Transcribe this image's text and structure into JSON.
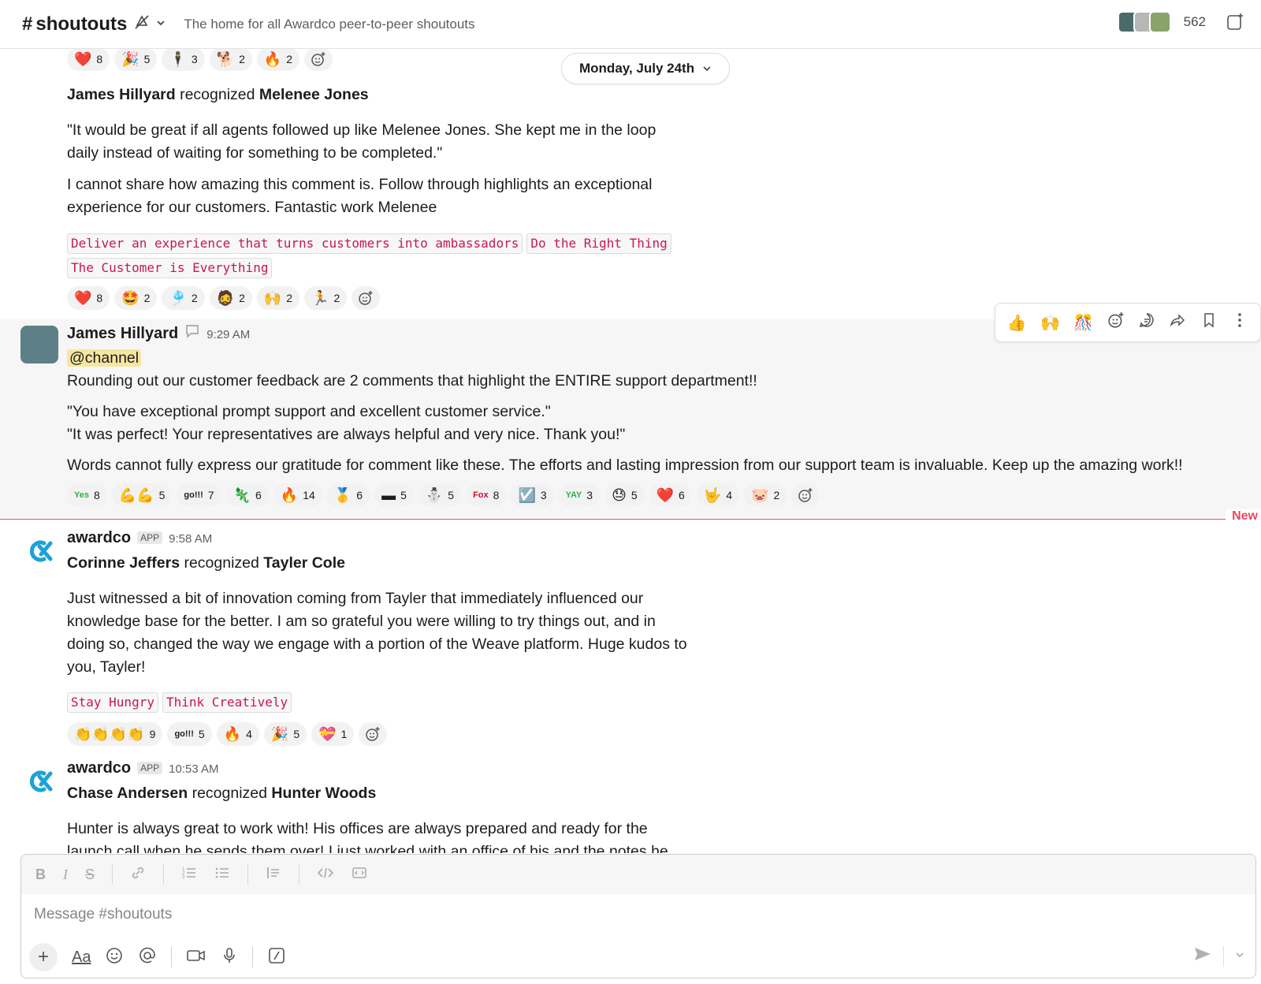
{
  "header": {
    "hash": "#",
    "channel_name": "shoutouts",
    "topic": "The home for all Awardco peer-to-peer shoutouts",
    "member_count": "562"
  },
  "date_pill": {
    "label": "Monday, July 24th"
  },
  "messages": [
    {
      "top_reactions": [
        {
          "emoji": "❤️",
          "count": "8"
        },
        {
          "emoji": "🎉",
          "count": "5"
        },
        {
          "emoji": "🕴",
          "count": "3"
        },
        {
          "emoji": "🐕",
          "count": "2"
        },
        {
          "emoji": "🔥",
          "count": "2"
        }
      ],
      "giver": "James Hillyard",
      "verb": "recognized",
      "receiver": "Melenee Jones",
      "quote": "\"It would be great if all agents followed up like Melenee Jones.  She kept me in the loop daily instead of waiting for something to be completed.\"",
      "comment": "I cannot share how amazing this comment is. Follow through highlights an exceptional experience for our customers. Fantastic work Melenee",
      "tags": [
        "Deliver an experience that turns customers into ambassadors",
        "Do the Right Thing",
        "The Customer is Everything"
      ],
      "reactions": [
        {
          "emoji": "❤️",
          "count": "8"
        },
        {
          "emoji": "🤩",
          "count": "2"
        },
        {
          "emoji": "🎐",
          "count": "2"
        },
        {
          "emoji": "🧔",
          "count": "2"
        },
        {
          "emoji": "🙌",
          "count": "2"
        },
        {
          "emoji": "🏃",
          "count": "2"
        }
      ]
    },
    {
      "sender": "James Hillyard",
      "time": "9:29 AM",
      "mention": "@channel",
      "line1": "Rounding out our customer feedback are 2 comments that highlight the ENTIRE support department!!",
      "quote1": "\"You have exceptional prompt support and excellent customer service.\"",
      "quote2": "\"It was perfect! Your representatives are always helpful and very nice. Thank you!\"",
      "line2": "Words cannot fully express our gratitude for comment like these. The efforts and lasting impression from our support team is invaluable. Keep up the amazing work!!",
      "reactions": [
        {
          "emoji": "Yes",
          "count": "8",
          "text": true
        },
        {
          "emoji": "💪💪",
          "count": "5"
        },
        {
          "emoji": "go!!!",
          "count": "7",
          "text": true
        },
        {
          "emoji": "🦎",
          "count": "6"
        },
        {
          "emoji": "🔥",
          "count": "14"
        },
        {
          "emoji": "🥇",
          "count": "6"
        },
        {
          "emoji": "▬",
          "count": "5"
        },
        {
          "emoji": "⛄",
          "count": "5"
        },
        {
          "emoji": "Fox",
          "count": "8",
          "text": true
        },
        {
          "emoji": "☑️",
          "count": "3"
        },
        {
          "emoji": "YAY",
          "count": "3",
          "text": true
        },
        {
          "emoji": "😓",
          "count": "5"
        },
        {
          "emoji": "❤️",
          "count": "6"
        },
        {
          "emoji": "🤟",
          "count": "4"
        },
        {
          "emoji": "🐷",
          "count": "2"
        }
      ]
    },
    {
      "sender": "awardco",
      "badge": "APP",
      "time": "9:58 AM",
      "giver": "Corinne Jeffers",
      "verb": "recognized",
      "receiver": "Tayler Cole",
      "body": "Just witnessed a bit of innovation coming from Tayler that immediately influenced our knowledge base for the better.  I am so grateful you were willing to try things out, and in doing so, changed the way we engage with a portion of the Weave platform.  Huge kudos to you, Tayler!",
      "tags": [
        "Stay Hungry",
        "Think Creatively"
      ],
      "reactions": [
        {
          "emoji": "👏👏👏👏",
          "count": "9"
        },
        {
          "emoji": "go!!!",
          "count": "5",
          "text": true
        },
        {
          "emoji": "🔥",
          "count": "4"
        },
        {
          "emoji": "🎉",
          "count": "5"
        },
        {
          "emoji": "💝",
          "count": "1"
        }
      ]
    },
    {
      "sender": "awardco",
      "badge": "APP",
      "time": "10:53 AM",
      "giver": "Chase Andersen",
      "verb": "recognized",
      "receiver": "Hunter Woods",
      "body": "Hunter is always great to work with! His offices are always prepared and ready for the launch call when he sends them over! I just worked with an office of his and the notes he"
    }
  ],
  "new_label": "New",
  "hover_toolbar": [
    "👍",
    "🙌",
    "🎊"
  ],
  "composer": {
    "placeholder": "Message #shoutouts",
    "format_label": "Aa"
  },
  "colors": {
    "tag_text": "#c9184a",
    "new_divider": "#e8475f",
    "mention_bg": "#f8e6a0",
    "awardco_brand": "#1aa3d9"
  }
}
